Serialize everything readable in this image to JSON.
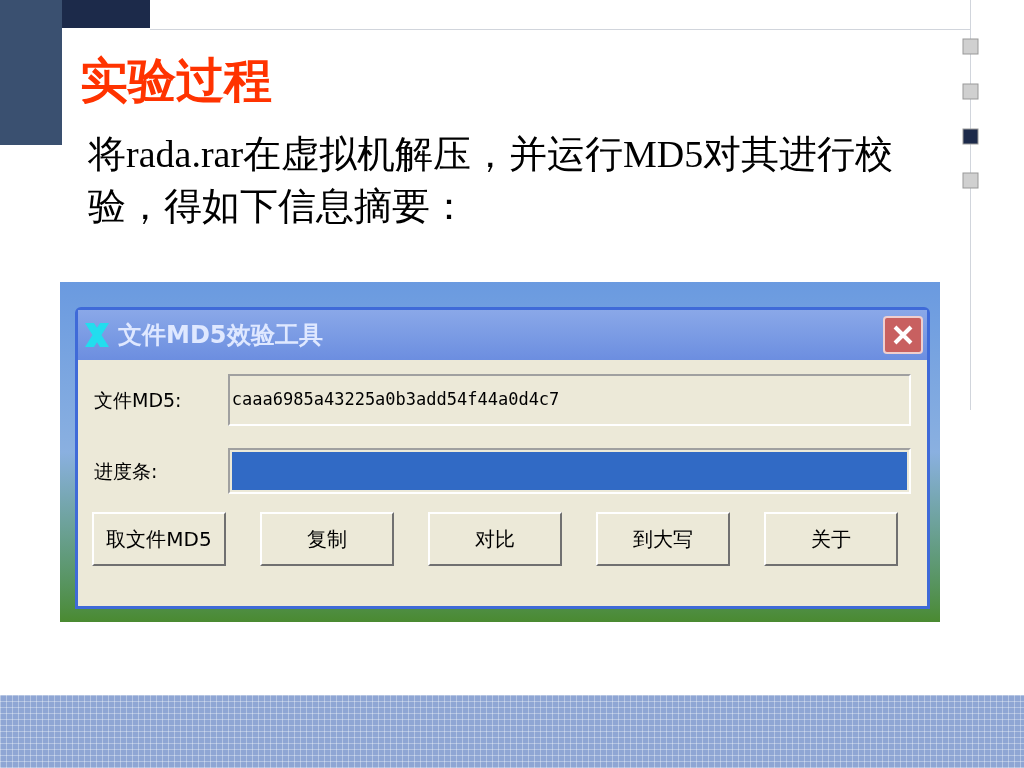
{
  "slide": {
    "title": "实验过程",
    "body": "将rada.rar在虚拟机解压，并运行MD5对其进行校验，得如下信息摘要："
  },
  "dialog": {
    "title": "文件MD5效验工具",
    "hash": {
      "label": "文件MD5:",
      "value": "caaa6985a43225a0b3add54f44a0d4c7"
    },
    "progress": {
      "label": "进度条:",
      "level": 1
    },
    "buttons": [
      "取文件MD5",
      "复制",
      "对比",
      "到大写",
      "关于"
    ]
  }
}
